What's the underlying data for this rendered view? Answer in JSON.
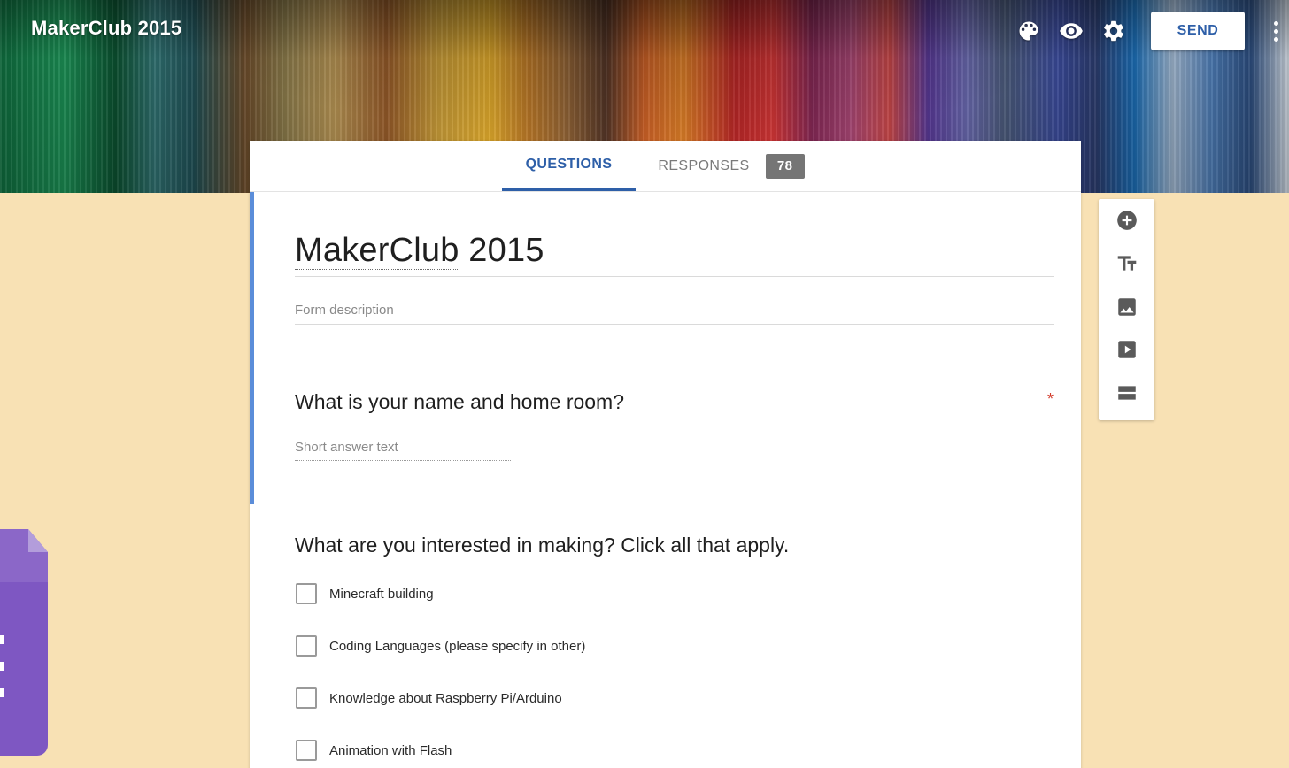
{
  "header": {
    "app_title": "MakerClub 2015",
    "send_label": "SEND",
    "icons": [
      "palette-icon",
      "preview-eye-icon",
      "settings-gear-icon",
      "more-vert-icon"
    ]
  },
  "tabs": {
    "questions_label": "QUESTIONS",
    "responses_label": "RESPONSES",
    "responses_count": "78"
  },
  "form": {
    "title_part1": "MakerClub",
    "title_part2": " 2015",
    "description_placeholder": "Form description"
  },
  "questions": [
    {
      "title": "What is your name and home room?",
      "required_mark": "*",
      "answer_placeholder": "Short answer text"
    },
    {
      "title": "What are you interested in making? Click all that apply.",
      "options": [
        "Minecraft building",
        "Coding Languages (please specify in other)",
        "Knowledge about Raspberry Pi/Arduino",
        "Animation with Flash"
      ]
    }
  ],
  "side_toolbar": {
    "icons": [
      "add-question-icon",
      "add-title-icon",
      "add-image-icon",
      "add-video-icon",
      "add-section-icon"
    ]
  },
  "colors": {
    "accent": "#2e5fa8",
    "page_background": "#f8e1b4",
    "active_bar": "#5b8dd9",
    "required": "#d23a2a",
    "badge": "#757575",
    "forms_logo": "#7e57c2"
  }
}
